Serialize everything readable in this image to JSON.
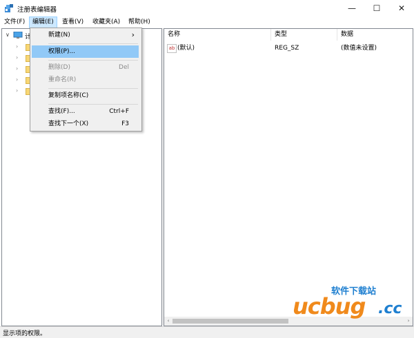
{
  "window": {
    "title": "注册表编辑器",
    "min_glyph": "—",
    "max_glyph": "☐",
    "close_glyph": "✕"
  },
  "menubar": [
    "文件(F)",
    "编辑(E)",
    "查看(V)",
    "收藏夹(A)",
    "帮助(H)"
  ],
  "menubar_active": "编辑(E)",
  "edit_menu": {
    "items": [
      {
        "label": "新建(N)",
        "shortcut": "",
        "submenu_glyph": "›",
        "disabled": false,
        "highlighted": false
      },
      {
        "label": "权限(P)...",
        "shortcut": "",
        "disabled": false,
        "highlighted": true
      },
      {
        "label": "删除(D)",
        "shortcut": "Del",
        "disabled": true,
        "highlighted": false
      },
      {
        "label": "重命名(R)",
        "shortcut": "",
        "disabled": true,
        "highlighted": false
      },
      {
        "label": "复制项名称(C)",
        "shortcut": "",
        "disabled": false,
        "highlighted": false
      },
      {
        "label": "查找(F)...",
        "shortcut": "Ctrl+F",
        "disabled": false,
        "highlighted": false
      },
      {
        "label": "查找下一个(X)",
        "shortcut": "F3",
        "disabled": false,
        "highlighted": false
      }
    ]
  },
  "tree": {
    "root_glyph_expanded": "∨",
    "root_partial": "计",
    "collapsed_glyph": "›"
  },
  "values_table": {
    "columns": [
      "名称",
      "类型",
      "数据"
    ],
    "rows": [
      {
        "icon": "ab",
        "name": "(默认)",
        "type": "REG_SZ",
        "data": "(数值未设置)"
      }
    ]
  },
  "scroll": {
    "left_glyph": "‹",
    "right_glyph": "›"
  },
  "status": "显示项的权限。",
  "watermark": {
    "text_top": "软件下载站",
    "text_brand": "ucbug",
    "text_tld": ".cc"
  },
  "colors": {
    "highlight": "#91c9f7",
    "menu_active": "#cce8ff",
    "brand_orange": "#f08a1c",
    "brand_blue": "#1e7fd0"
  }
}
